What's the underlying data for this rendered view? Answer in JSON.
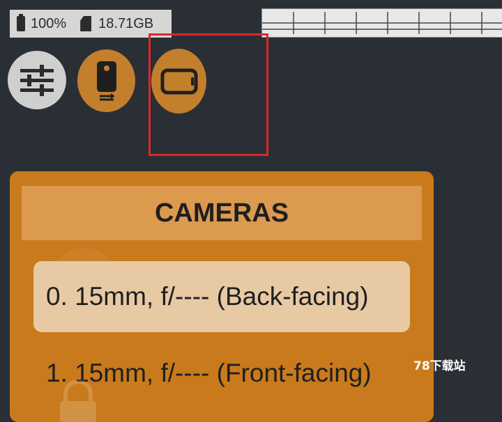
{
  "status": {
    "battery": "100%",
    "storage": "18.71GB",
    "battery_icon": "battery-full-icon",
    "storage_icon": "sd-card-icon"
  },
  "toolbar": {
    "settings_icon": "sliders-icon",
    "phone_icon": "phone-transfer-icon",
    "orientation_icon": "landscape-orientation-icon"
  },
  "panel": {
    "title": "CAMERAS",
    "items": [
      {
        "label": "0. 15mm, f/---- (Back-facing)",
        "selected": true
      },
      {
        "label": "1. 15mm, f/---- (Front-facing)",
        "selected": false
      }
    ]
  },
  "watermark": "78下载站",
  "colors": {
    "background": "#2a2f36",
    "accent": "#c97a1c",
    "header": "#dc9a4e",
    "selected": "#e7c9a4",
    "highlight": "#e0262a"
  }
}
